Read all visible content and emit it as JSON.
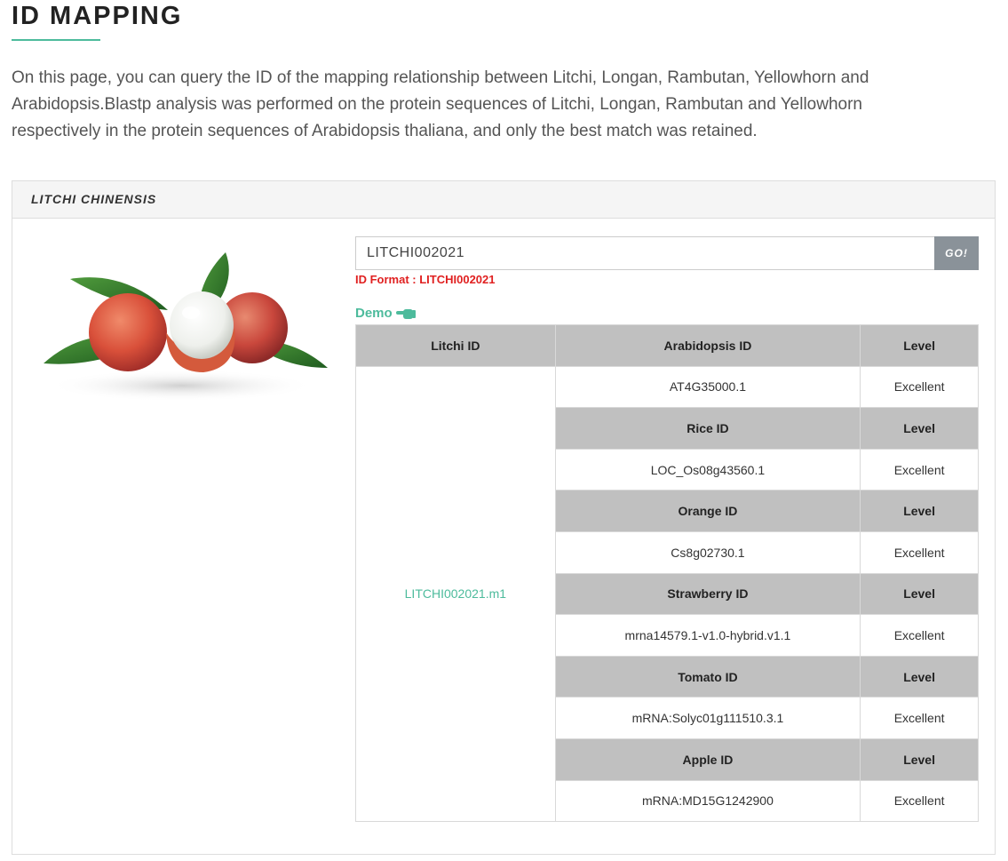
{
  "page": {
    "title": "ID MAPPING",
    "intro": "On this page, you can query the ID of the mapping relationship between Litchi, Longan, Rambutan, Yellowhorn and Arabidopsis.Blastp analysis was performed on the protein sequences of Litchi, Longan, Rambutan and Yellowhorn respectively in the protein sequences of Arabidopsis thaliana, and only the best match was retained."
  },
  "panel": {
    "heading": "LITCHI CHINENSIS",
    "image_alt": "litchi-fruit-image"
  },
  "search": {
    "value": "LITCHI002021",
    "button_label": "GO!",
    "format_hint": "ID Format : LITCHI002021",
    "demo_label": "Demo",
    "demo_icon": "pointing-hand-icon"
  },
  "results": {
    "litchi_header": "Litchi ID",
    "litchi_id": "LITCHI002021.m1",
    "level_header": "Level",
    "groups": [
      {
        "header": "Arabidopsis ID",
        "id": "AT4G35000.1",
        "level": "Excellent"
      },
      {
        "header": "Rice ID",
        "id": "LOC_Os08g43560.1",
        "level": "Excellent"
      },
      {
        "header": "Orange ID",
        "id": "Cs8g02730.1",
        "level": "Excellent"
      },
      {
        "header": "Strawberry ID",
        "id": "mrna14579.1-v1.0-hybrid.v1.1",
        "level": "Excellent"
      },
      {
        "header": "Tomato ID",
        "id": "mRNA:Solyc01g111510.3.1",
        "level": "Excellent"
      },
      {
        "header": "Apple ID",
        "id": "mRNA:MD15G1242900",
        "level": "Excellent"
      }
    ]
  },
  "colors": {
    "accent": "#4dbb9c",
    "error": "#e02020",
    "table_header_bg": "#c0c0c0",
    "go_button_bg": "#8a9299"
  }
}
